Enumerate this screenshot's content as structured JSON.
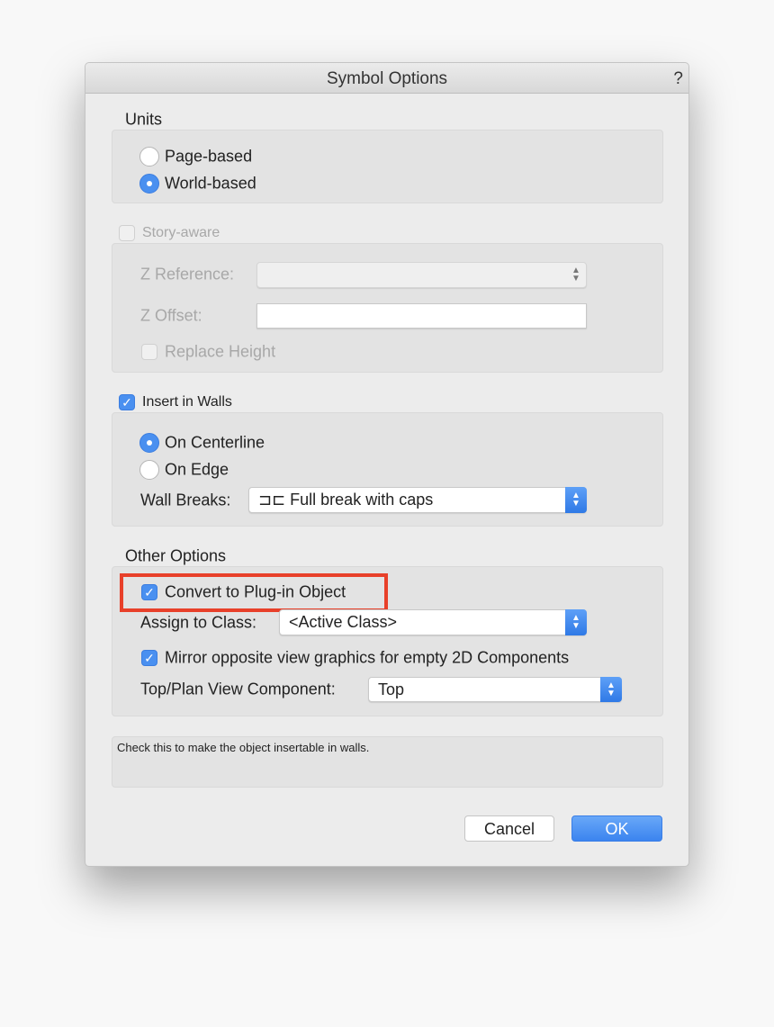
{
  "dialog": {
    "title": "Symbol Options",
    "help": "?"
  },
  "units": {
    "label": "Units",
    "options": [
      {
        "label": "Page-based",
        "selected": false
      },
      {
        "label": "World-based",
        "selected": true
      }
    ]
  },
  "story": {
    "label": "Story-aware",
    "checked": false,
    "disabled": true,
    "z_reference_label": "Z Reference:",
    "z_reference_value": "",
    "z_offset_label": "Z Offset:",
    "z_offset_value": "",
    "replace_height_label": "Replace Height"
  },
  "walls": {
    "label": "Insert in Walls",
    "checked": true,
    "options": [
      {
        "label": "On Centerline",
        "selected": true
      },
      {
        "label": "On Edge",
        "selected": false
      }
    ],
    "wall_breaks_label": "Wall Breaks:",
    "wall_breaks_value": "⊐⊏ Full break with caps"
  },
  "other": {
    "label": "Other Options",
    "convert_label": "Convert to Plug-in Object",
    "convert_checked": true,
    "highlight_color": "#e8402a",
    "assign_class_label": "Assign to Class:",
    "assign_class_value": "<Active Class>",
    "mirror_label": "Mirror opposite view graphics for empty 2D Components",
    "mirror_checked": true,
    "top_plan_label": "Top/Plan View Component:",
    "top_plan_value": "Top"
  },
  "help_text": "Check this to make the object insertable in walls.",
  "buttons": {
    "cancel": "Cancel",
    "ok": "OK"
  },
  "colors": {
    "accent": "#4a90f0"
  }
}
